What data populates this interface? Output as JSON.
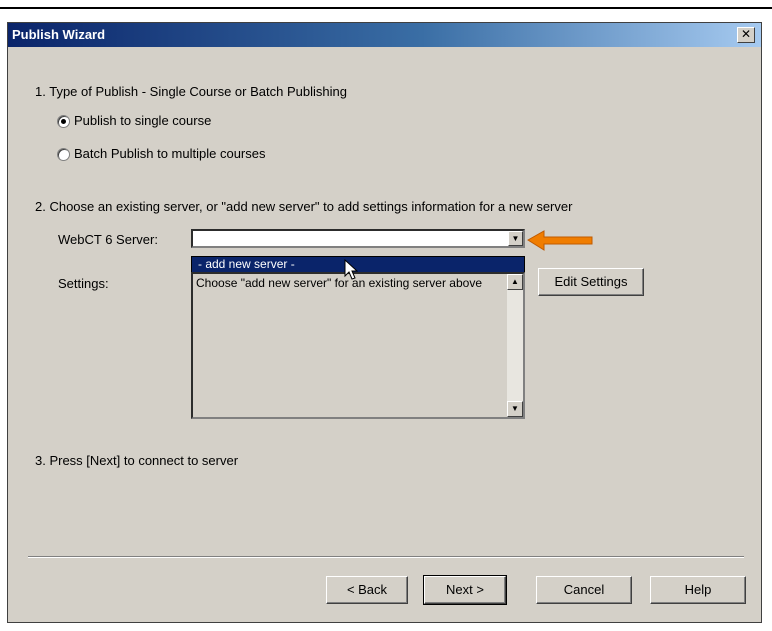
{
  "window": {
    "title": "Publish Wizard",
    "close_glyph": "✕"
  },
  "step1": {
    "label": "1.  Type of Publish - Single Course or Batch Publishing",
    "options": [
      {
        "label": "Publish to single course",
        "checked": true
      },
      {
        "label": "Batch Publish to multiple courses",
        "checked": false
      }
    ]
  },
  "step2": {
    "label": "2.  Choose an existing server, or \"add new server\" to add settings information for a new server",
    "server_label": "WebCT 6 Server:",
    "server_value": "",
    "dropdown_option": "- add new server -",
    "settings_label": "Settings:",
    "settings_text": "Choose \"add new server\" for an existing server above",
    "edit_settings_button": "Edit Settings"
  },
  "step3": {
    "label": "3.  Press [Next] to connect to server"
  },
  "footer": {
    "back_button": "< Back",
    "next_button": "Next >",
    "cancel_button": "Cancel",
    "help_button": "Help"
  },
  "colors": {
    "titlebar": "#0a246a",
    "face": "#d4d0c8",
    "highlight": "#0a246a",
    "arrow": "#f07d00"
  },
  "icons": {
    "close": "close-icon",
    "combo": "chevron-down-icon",
    "arrow": "orange-arrow-icon",
    "cursor": "mouse-pointer-icon"
  }
}
